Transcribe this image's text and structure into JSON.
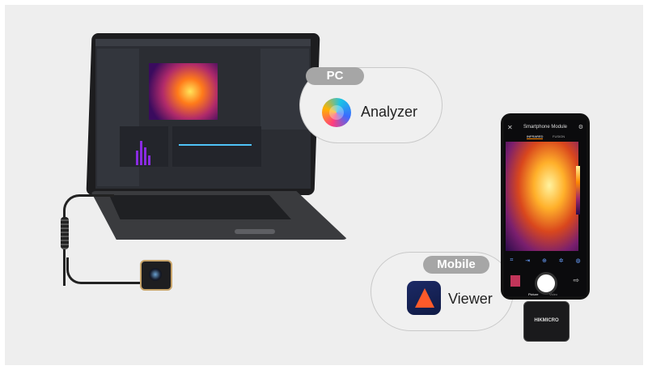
{
  "labels": {
    "pc_tag": "PC",
    "analyzer": "Analyzer",
    "mobile_tag": "Mobile",
    "viewer": "Viewer"
  },
  "phone": {
    "title": "Smartphone Module",
    "tab_infrared": "INFRARED",
    "tab_fusion": "FUSION",
    "mode_picture": "Picture",
    "mode_video": "Video",
    "module_logo": "HIKMICRO"
  },
  "colors": {
    "tag_bg": "#a6a6a6",
    "pill_border": "#c9c9c9",
    "background": "#eeeeee"
  }
}
